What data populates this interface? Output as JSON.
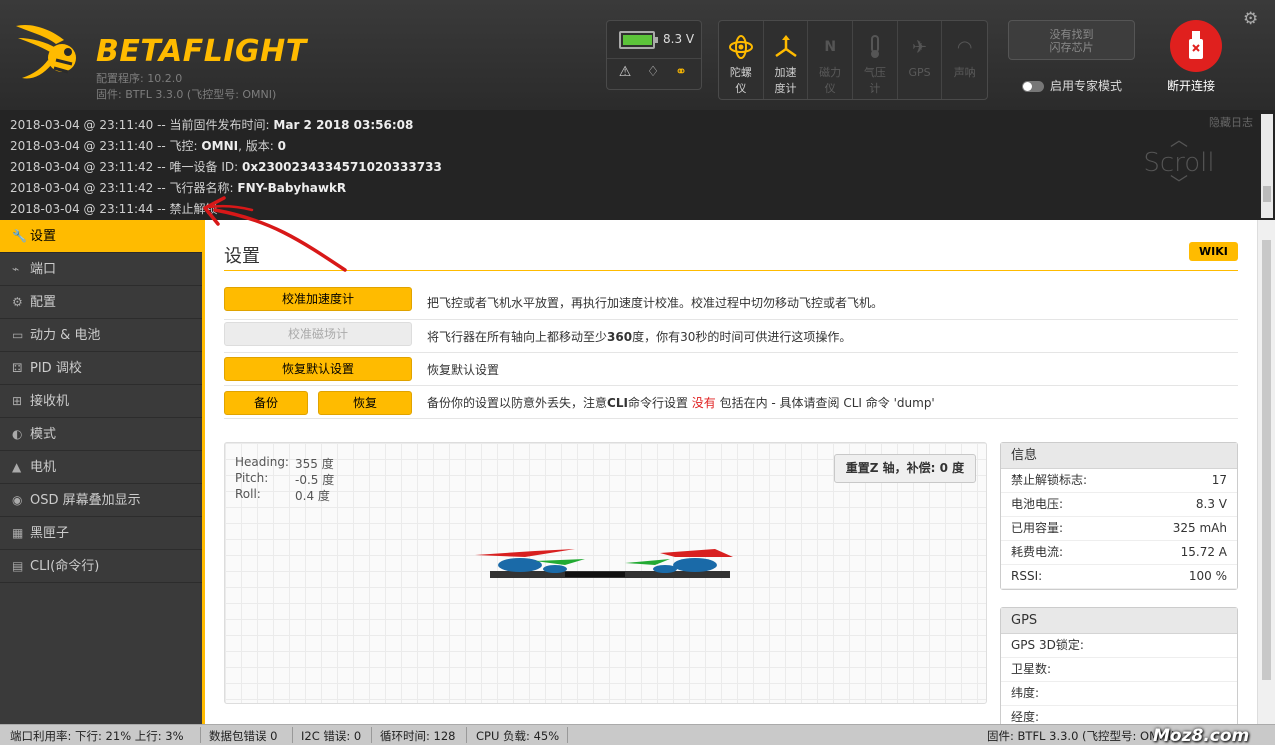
{
  "header": {
    "brand": "BETAFLIGHT",
    "configurator_version": "配置程序: 10.2.0",
    "firmware": "固件: BTFL 3.3.0 (飞控型号: OMNI)",
    "battery_voltage": "8.3 V",
    "battery_level": 0.9,
    "sensors": [
      {
        "label": "陀螺仪",
        "icon": "gyro-icon",
        "active": true
      },
      {
        "label": "加速度计",
        "icon": "accelerometer-icon",
        "active": true
      },
      {
        "label": "磁力仪",
        "icon": "magnetometer-icon",
        "active": false
      },
      {
        "label": "气压计",
        "icon": "barometer-icon",
        "active": false
      },
      {
        "label": "GPS",
        "icon": "gps-icon",
        "active": false
      },
      {
        "label": "声呐",
        "icon": "sonar-icon",
        "active": false
      }
    ],
    "dataflash": "没有找到\n闪存芯片",
    "expert_mode": "启用专家模式",
    "disconnect": "断开连接"
  },
  "log": {
    "hide_label": "隐藏日志",
    "scroll_hint": "Scroll",
    "lines": [
      {
        "prefix": "2018-03-04 @ 23:11:40 -- 当前固件发布时间: ",
        "bold": "Mar 2 2018 03:56:08",
        "suffix": ""
      },
      {
        "prefix": "2018-03-04 @ 23:11:40 -- 飞控: ",
        "bold": "OMNI",
        "suffix": ", 版本: ",
        "bold2": "0"
      },
      {
        "prefix": "2018-03-04 @ 23:11:42 -- 唯一设备 ID: ",
        "bold": "0x2300234334571020333733",
        "suffix": ""
      },
      {
        "prefix": "2018-03-04 @ 23:11:42 -- 飞行器名称: ",
        "bold": "FNY-BabyhawkR",
        "suffix": ""
      },
      {
        "prefix": "2018-03-04 @ 23:11:44 -- 禁止解锁",
        "bold": "",
        "suffix": ""
      }
    ]
  },
  "sidebar": {
    "items": [
      {
        "label": "设置",
        "icon": "wrench-icon",
        "glyph": "🔧"
      },
      {
        "label": "端口",
        "icon": "plug-icon",
        "glyph": "⌁"
      },
      {
        "label": "配置",
        "icon": "gear-icon",
        "glyph": "⚙"
      },
      {
        "label": "动力 & 电池",
        "icon": "battery-icon",
        "glyph": "▭"
      },
      {
        "label": "PID 调校",
        "icon": "sitemap-icon",
        "glyph": "⚃"
      },
      {
        "label": "接收机",
        "icon": "receiver-icon",
        "glyph": "⊞"
      },
      {
        "label": "模式",
        "icon": "toggle-icon",
        "glyph": "◐"
      },
      {
        "label": "电机",
        "icon": "motor-icon",
        "glyph": "▲"
      },
      {
        "label": "OSD 屏幕叠加显示",
        "icon": "osd-icon",
        "glyph": "◉"
      },
      {
        "label": "黑匣子",
        "icon": "blackbox-icon",
        "glyph": "▦"
      },
      {
        "label": "CLI(命令行)",
        "icon": "terminal-icon",
        "glyph": "▤"
      }
    ]
  },
  "main": {
    "title": "设置",
    "wiki": "WIKI",
    "actions": {
      "calibrate_acc": "校准加速度计",
      "calibrate_acc_desc": "把飞控或者飞机水平放置，再执行加速度计校准。校准过程中切勿移动飞控或者飞机。",
      "calibrate_mag": "校准磁场计",
      "calibrate_mag_desc_a": "将飞行器在所有轴向上都移动至少",
      "calibrate_mag_desc_b": "360",
      "calibrate_mag_desc_c": "度，你有30秒的时间可供进行这项操作。",
      "reset": "恢复默认设置",
      "reset_desc": "恢复默认设置",
      "backup": "备份",
      "restore": "恢复",
      "backup_desc_a": "备份你的设置以防意外丢失，注意",
      "backup_desc_b": "CLI",
      "backup_desc_c": "命令行设置 ",
      "backup_desc_d": "没有",
      "backup_desc_e": " 包括在内 - 具体请查阅 CLI 命令 'dump'"
    },
    "attitude": {
      "heading_label": "Heading:",
      "heading": "355 度",
      "pitch_label": "Pitch:",
      "pitch": "-0.5 度",
      "roll_label": "Roll:",
      "roll": "0.4 度"
    },
    "reset_z": "重置Z 轴，补偿: 0 度",
    "info": {
      "title": "信息",
      "rows": [
        {
          "label": "禁止解锁标志:",
          "value": "17"
        },
        {
          "label": "电池电压:",
          "value": "8.3 V"
        },
        {
          "label": "已用容量:",
          "value": "325 mAh"
        },
        {
          "label": "耗费电流:",
          "value": "15.72 A"
        },
        {
          "label": "RSSI:",
          "value": "100 %"
        }
      ]
    },
    "gps": {
      "title": "GPS",
      "rows": [
        {
          "label": "GPS 3D锁定:",
          "value": ""
        },
        {
          "label": "卫星数:",
          "value": ""
        },
        {
          "label": "纬度:",
          "value": ""
        },
        {
          "label": "经度:",
          "value": ""
        }
      ]
    }
  },
  "status": {
    "port_usage": "端口利用率:   下行: 21% 上行: 3%",
    "packet_error": "数据包错误 0",
    "i2c_error": "I2C 错误: 0",
    "cycle_time": "循环时间: 128",
    "cpu_load": "CPU 负载: 45%",
    "firmware": "固件: BTFL 3.3.0 (飞控型号: OMNI)",
    "watermark": "Moz8.com"
  },
  "colors": {
    "accent": "#ffbb00",
    "annotation": "#d81818",
    "disconnect": "#e0201e"
  }
}
